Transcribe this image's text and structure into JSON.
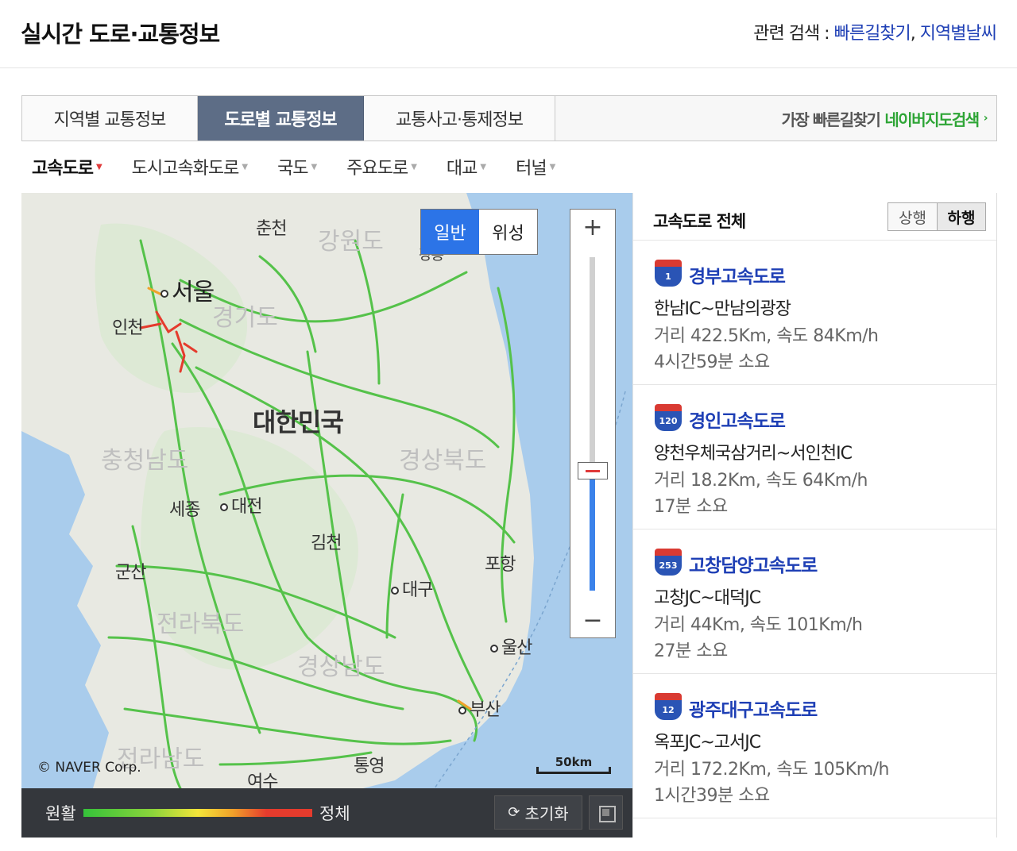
{
  "header": {
    "title": "실시간 도로·교통정보",
    "related_prefix": "관련 검색 :",
    "related_links": [
      "빠른길찾기",
      "지역별날씨"
    ],
    "separator": ","
  },
  "tabs": [
    {
      "label": "지역별 교통정보",
      "active": false
    },
    {
      "label": "도로별 교통정보",
      "active": true
    },
    {
      "label": "교통사고·통제정보",
      "active": false
    }
  ],
  "tab_promo": {
    "prefix": "가장 빠른길찾기",
    "link": "네이버지도검색",
    "arrow": "›"
  },
  "road_types": [
    {
      "label": "고속도로",
      "active": true
    },
    {
      "label": "도시고속화도로",
      "active": false
    },
    {
      "label": "국도",
      "active": false
    },
    {
      "label": "주요도로",
      "active": false
    },
    {
      "label": "대교",
      "active": false
    },
    {
      "label": "터널",
      "active": false
    }
  ],
  "map": {
    "map_type": [
      "일반",
      "위성"
    ],
    "map_type_active": "일반",
    "zoom_plus": "+",
    "zoom_minus": "−",
    "zoom_level": 0.36,
    "labels": {
      "chuncheon": "춘천",
      "gangwon": "강원도",
      "gangneung": "강릉",
      "seoul": "서울",
      "gyeonggi": "경기도",
      "incheon": "인천",
      "korea": "대한민국",
      "chungnam": "충청남도",
      "gyeongbuk": "경상북도",
      "sejong": "세종",
      "daejeon": "대전",
      "gimcheon": "김천",
      "pohang": "포항",
      "gunsan": "군산",
      "daegu": "대구",
      "jeonbuk": "전라북도",
      "ulsan": "울산",
      "gyeongnam": "경상남도",
      "busan": "부산",
      "jeonnam": "전라남도",
      "tongyeong": "통영",
      "yeosu": "여수"
    },
    "copyright": "© NAVER Corp.",
    "scale": "50km"
  },
  "map_footer": {
    "legend_low": "원활",
    "legend_high": "정체",
    "reset": "초기화"
  },
  "panel": {
    "title": "고속도로 전체",
    "dir_up": "상행",
    "dir_down": "하행",
    "dir_active": "하행",
    "roads": [
      {
        "number": "1",
        "name": "경부고속도로",
        "section": "한남IC~만남의광장",
        "distance": "거리 422.5Km, 속도 84Km/h",
        "time": "4시간59분 소요"
      },
      {
        "number": "120",
        "name": "경인고속도로",
        "section": "양천우체국삼거리~서인천IC",
        "distance": "거리 18.2Km, 속도 64Km/h",
        "time": "17분 소요"
      },
      {
        "number": "253",
        "name": "고창담양고속도로",
        "section": "고창JC~대덕JC",
        "distance": "거리 44Km, 속도 101Km/h",
        "time": "27분 소요"
      },
      {
        "number": "12",
        "name": "광주대구고속도로",
        "section": "옥포JC~고서JC",
        "distance": "거리 172.2Km, 속도 105Km/h",
        "time": "1시간39분 소요"
      }
    ]
  },
  "colors": {
    "accent_blue": "#2c74e7",
    "link_blue": "#1e3fb5",
    "active_tab": "#5d6d86",
    "promo_green": "#2ea536",
    "traffic_green": "#35c23a",
    "traffic_red": "#e53b2d"
  }
}
